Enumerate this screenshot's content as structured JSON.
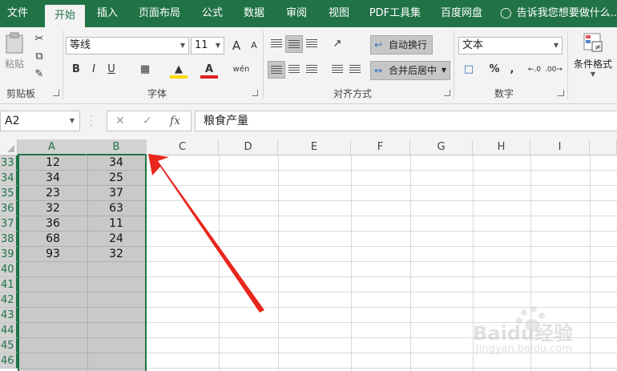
{
  "tabs": [
    {
      "label": "文件",
      "active": false
    },
    {
      "label": "开始",
      "active": true
    },
    {
      "label": "插入",
      "active": false
    },
    {
      "label": "页面布局",
      "active": false
    },
    {
      "label": "公式",
      "active": false
    },
    {
      "label": "数据",
      "active": false
    },
    {
      "label": "审阅",
      "active": false
    },
    {
      "label": "视图",
      "active": false
    },
    {
      "label": "PDF工具集",
      "active": false
    },
    {
      "label": "百度网盘",
      "active": false
    }
  ],
  "tell_me": "告诉我您想要做什么...",
  "ribbon": {
    "clipboard": {
      "paste": "粘贴",
      "group": "剪贴板"
    },
    "font": {
      "family": "等线",
      "size": "11",
      "bold": "B",
      "italic": "I",
      "underline": "U",
      "group": "字体",
      "grow": "A",
      "shrink": "A",
      "phonetic": "wén"
    },
    "alignment": {
      "wrap": "自动换行",
      "merge": "合并后居中",
      "group": "对齐方式"
    },
    "number": {
      "format": "文本",
      "percent": "%",
      "comma": ",",
      "group": "数字"
    },
    "styles": {
      "conditional": "条件格式"
    }
  },
  "formula_bar": {
    "name_box": "A2",
    "cancel": "✕",
    "enter": "✓",
    "fx": "fx",
    "content": "粮食产量"
  },
  "columns": [
    "A",
    "B",
    "C",
    "D",
    "E",
    "F",
    "G",
    "H",
    "I"
  ],
  "rows": [
    "33",
    "34",
    "35",
    "36",
    "37",
    "38",
    "39",
    "40",
    "41",
    "42",
    "43",
    "44",
    "45",
    "46"
  ],
  "cells_A": [
    "12",
    "34",
    "23",
    "32",
    "36",
    "68",
    "93",
    "",
    "",
    "",
    "",
    "",
    "",
    ""
  ],
  "cells_B": [
    "34",
    "25",
    "37",
    "63",
    "11",
    "24",
    "32",
    "",
    "",
    "",
    "",
    "",
    "",
    ""
  ],
  "watermark": {
    "brand": "Baidu经验",
    "url": "jingyan.baidu.com"
  },
  "colors": {
    "accent": "#217346",
    "arrow": "#e8261c"
  }
}
